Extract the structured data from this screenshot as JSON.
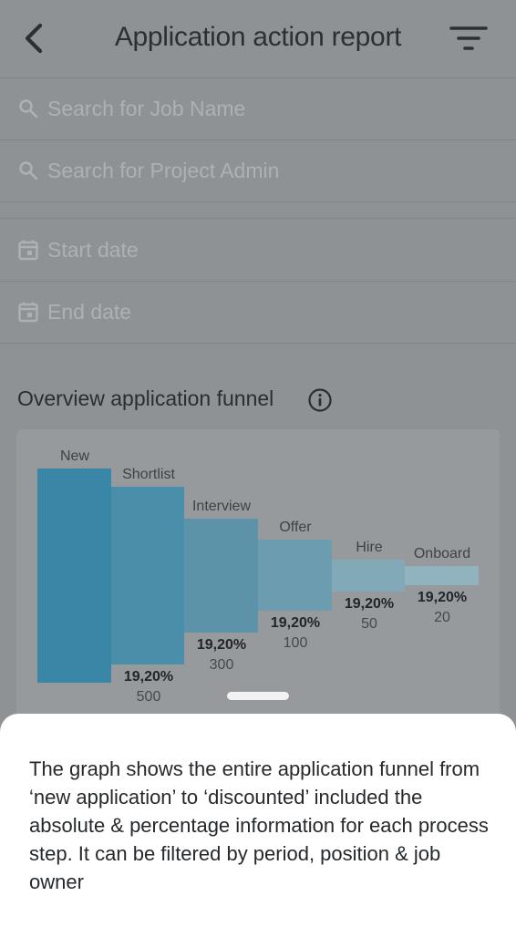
{
  "header": {
    "title": "Application action report"
  },
  "search": {
    "job_name_placeholder": "Search for Job Name",
    "project_admin_placeholder": "Search for Project Admin"
  },
  "dates": {
    "start_placeholder": "Start date",
    "end_placeholder": "End date"
  },
  "overview": {
    "title": "Overview application funnel"
  },
  "chart_data": {
    "type": "bar",
    "categories": [
      "New",
      "Shortlist",
      "Interview",
      "Offer",
      "Hire",
      "Onboard"
    ],
    "percent_labels": [
      "",
      "19,20%",
      "19,20%",
      "19,20%",
      "19,20%",
      "19,20%"
    ],
    "count_labels": [
      "",
      "500",
      "300",
      "100",
      "50",
      "20"
    ],
    "colors": [
      "#3a86a6",
      "#4b8ea9",
      "#5d93a8",
      "#6c9caf",
      "#82a9b8",
      "#91b3c0"
    ]
  },
  "sheet": {
    "description": "The graph shows the entire application funnel from ‘new application’ to ‘discounted’ included the absolute & percentage information for each process step. It can be filtered by period, position & job owner"
  },
  "colors": {
    "overlay_bg": "#8f9294",
    "sheet_bg": "#ffffff"
  }
}
